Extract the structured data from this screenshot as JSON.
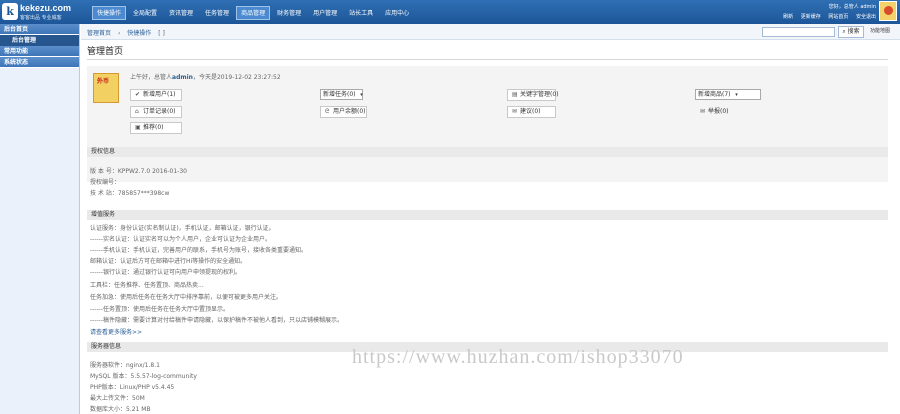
{
  "brand": {
    "logo_mark": "k",
    "name": "kekezu.com",
    "tagline": "客客出品  专业威客"
  },
  "menu": [
    {
      "label": "快捷操作",
      "active": true
    },
    {
      "label": "全局配置",
      "active": false
    },
    {
      "label": "资讯管理",
      "active": false
    },
    {
      "label": "任务管理",
      "active": false
    },
    {
      "label": "商品管理",
      "active": true
    },
    {
      "label": "财务管理",
      "active": false
    },
    {
      "label": "用户管理",
      "active": false
    },
    {
      "label": "站长工具",
      "active": false
    },
    {
      "label": "应用中心",
      "active": false
    }
  ],
  "top_right": {
    "greeting": "您好，总管人 admin",
    "links": [
      "刷新",
      "更新缓存",
      "网站首页",
      "安全退出"
    ]
  },
  "sidebar": {
    "head": "后台首页",
    "sub": "后台管理",
    "groups": [
      "常用功能",
      "系统状态"
    ]
  },
  "breadcrumb": [
    "管理首页",
    "快捷操作",
    "[ ]"
  ],
  "search": {
    "placeholder": "",
    "button_label": "搜索",
    "nav_label": "功能地图"
  },
  "page_title": "管理首页",
  "welcome": {
    "prefix": "上午好，总管人",
    "user": "admin",
    "suffix": "，今天是2019-12-02 23:27:52"
  },
  "quick_buttons": {
    "add_user": "新增用户(1)",
    "select_task": "新增任务(0)",
    "hot_words": "关键字管理(0)",
    "select_goods": "新增商品(7)",
    "recharge": "订单记录(0)",
    "user_balance": "用户余额(0)",
    "msg": "建议(0)",
    "report": "举报(0)",
    "promotion": "推荐(0)"
  },
  "license": {
    "title": "授权信息",
    "lines": [
      "版 本 号：KPPW2.7.0 2016-01-30",
      "授权编号：",
      "技 术 站：785857***398cw"
    ]
  },
  "value_added": {
    "title": "增值服务",
    "lines": [
      "认证服务：身份认证(实名制认证)，手机认证，邮箱认证，银行认证。",
      "------实名认证：认证实名可以为个人用户，企业可认证为企业用户。",
      "------手机认证：手机认证，完善用户的联系，手机号为账号，接收各类重要通知。",
      "        邮箱认证：认证后方可在邮箱中进行Hi等操作的安全通知。",
      "------银行认证：通过银行认证可向用户申领提现的权利。",
      "工具栏：任务推荐、任务置顶、商品热卖...",
      "        任务加急：使用后任务在任务大厅中排序靠前，以便可被更多用户关注。",
      "------任务置顶：使用后任务在任务大厅中置顶显示。",
      "------稿件隐藏：需要计算对付给稿件申请隐藏，以保护稿件不被他人看到，只以店铺模糊展示。"
    ],
    "more_link": "请查看更多服务>>"
  },
  "server": {
    "title": "服务器信息",
    "lines": [
      "服务器软件：nginx/1.8.1",
      "MySQL 版本：5.5.57-log-community",
      "PHP版本：Linux/PHP v5.4.45",
      "最大上传文件：50M",
      "数据库大小：5.21 MB"
    ]
  },
  "watermark": "https://www.huzhan.com/ishop33070"
}
